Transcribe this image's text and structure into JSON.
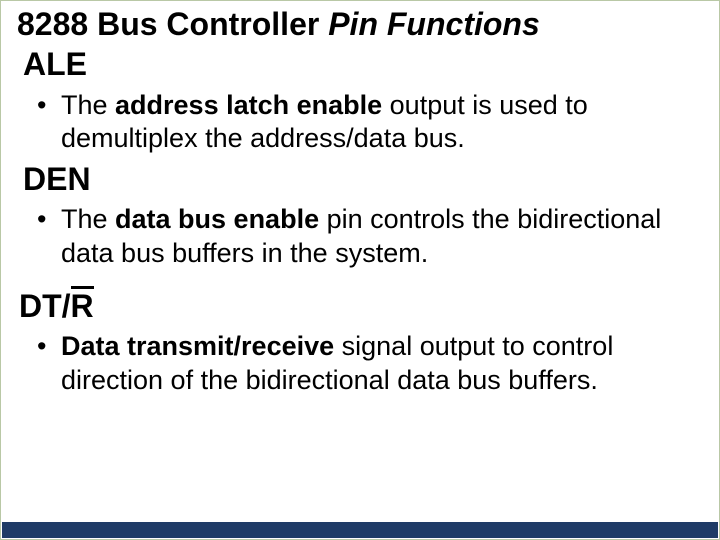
{
  "title": {
    "part1": "8288 Bus Controller ",
    "part2": "Pin Functions"
  },
  "sections": [
    {
      "signal_prefix": "",
      "signal_plain": "ALE",
      "signal_overbar": "",
      "bullet_pre": "The ",
      "bullet_bold": "address latch enable",
      "bullet_post": " output is used to demultiplex the address/data bus."
    },
    {
      "signal_prefix": "",
      "signal_plain": "DEN",
      "signal_overbar": "",
      "bullet_pre": "The ",
      "bullet_bold": "data bus enable",
      "bullet_post": " pin controls the bidirectional data bus buffers in the system."
    },
    {
      "signal_prefix": "DT/",
      "signal_plain": "",
      "signal_overbar": "R",
      "bullet_pre": "",
      "bullet_bold": "Data transmit/receive",
      "bullet_post": " signal output to control direction of the bidirectional data bus buffers."
    }
  ]
}
